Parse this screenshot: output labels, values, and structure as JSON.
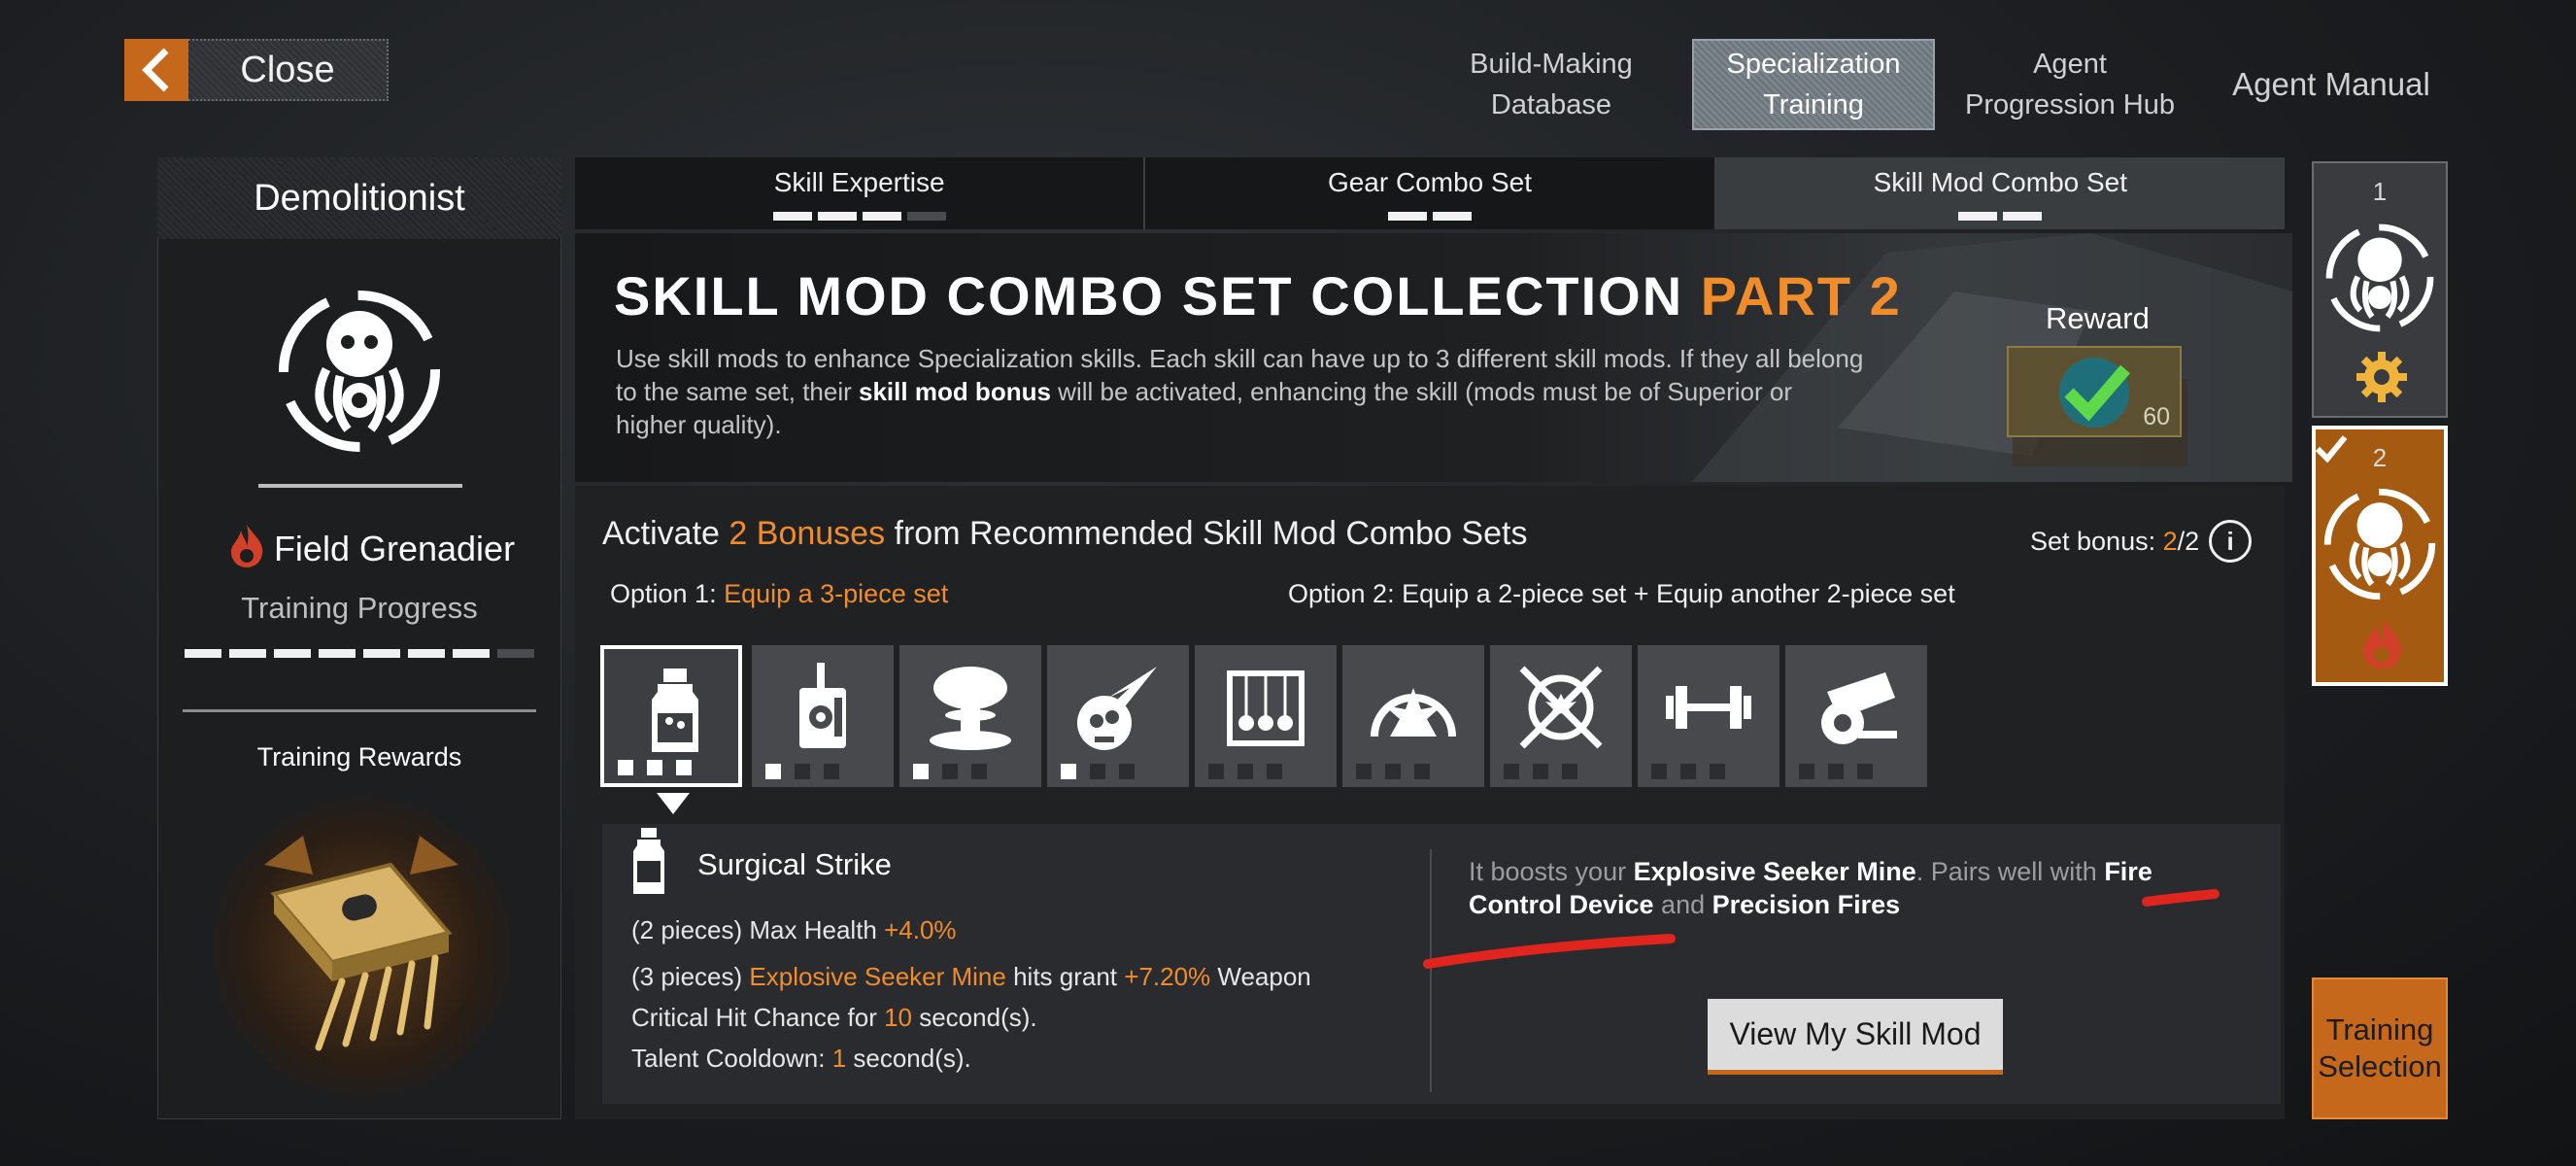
{
  "topbar": {
    "close_label": "Close",
    "nav": [
      {
        "label": "Build-Making Database",
        "active": false
      },
      {
        "label": "Specialization Training",
        "active": true
      },
      {
        "label": "Agent Progression Hub",
        "active": false
      },
      {
        "label": "Agent Manual",
        "active": false
      }
    ]
  },
  "left_panel": {
    "title": "Demolitionist",
    "specialization": "Field Grenadier",
    "progress_label": "Training Progress",
    "progress_segments_filled": 7,
    "progress_segments_total": 8,
    "rewards_label": "Training Rewards"
  },
  "tabs": [
    {
      "label": "Skill Expertise",
      "pips_on": 3,
      "pips_total": 4,
      "active": false
    },
    {
      "label": "Gear Combo Set",
      "pips_on": 2,
      "pips_total": 2,
      "active": false
    },
    {
      "label": "Skill Mod Combo Set",
      "pips_on": 2,
      "pips_total": 2,
      "active": true
    }
  ],
  "banner": {
    "title_main": "SKILL MOD COMBO SET COLLECTION",
    "title_part": "PART 2",
    "desc_1": "Use skill mods to enhance Specialization skills. Each skill can have up to 3 different skill mods. If they all belong to the same set, their ",
    "desc_bold": "skill mod bonus",
    "desc_2": " will be activated, enhancing the skill (mods must be of Superior or higher quality).",
    "reward_label": "Reward",
    "reward_amount": "60"
  },
  "activate": {
    "prefix": "Activate ",
    "count": "2",
    "bonuses": "Bonuses",
    "suffix": " from Recommended Skill Mod Combo Sets",
    "set_bonus_label": "Set bonus: ",
    "set_bonus_current": "2",
    "set_bonus_total": "/2",
    "option1_label": "Option 1: ",
    "option1_text": "Equip a 3-piece set",
    "option2_label": "Option 2: ",
    "option2_text": "Equip a 2-piece set + Equip another 2-piece set"
  },
  "mod_sets": [
    {
      "icon": "bottle-icon",
      "pips_on": 3
    },
    {
      "icon": "radio-device-icon",
      "pips_on": 1
    },
    {
      "icon": "mushroom-cloud-icon",
      "pips_on": 1
    },
    {
      "icon": "flaming-skull-icon",
      "pips_on": 1
    },
    {
      "icon": "newtons-cradle-icon",
      "pips_on": 0
    },
    {
      "icon": "explosion-dome-icon",
      "pips_on": 0
    },
    {
      "icon": "crosshair-burst-icon",
      "pips_on": 0
    },
    {
      "icon": "dumbbell-icon",
      "pips_on": 0
    },
    {
      "icon": "cannon-icon",
      "pips_on": 0
    }
  ],
  "detail": {
    "name": "Surgical Strike",
    "line1_prefix": "(2 pieces) Max Health ",
    "line1_value": "+4.0%",
    "line2_prefix": "(3 pieces) ",
    "line2_skill": "Explosive Seeker Mine",
    "line2_mid": " hits grant ",
    "line2_value": "+7.20%",
    "line2_suffix": " Weapon",
    "line3_prefix": "Critical Hit Chance for ",
    "line3_value": "10",
    "line3_suffix": " second(s).",
    "line4_prefix": "Talent Cooldown: ",
    "line4_value": "1",
    "line4_suffix": " second(s).",
    "pairs_1": "It boosts your ",
    "pairs_skill": "Explosive Seeker Mine",
    "pairs_2": ". Pairs well with ",
    "pairs_mod1": "Fire Control Device",
    "pairs_3": " and ",
    "pairs_mod2": "Precision Fires",
    "view_button": "View My Skill Mod"
  },
  "right_column": {
    "stage1_num": "1",
    "stage2_num": "2",
    "training_selection": "Training Selection"
  },
  "colors": {
    "accent_orange": "#f08c2a",
    "annotation_red": "#e0241e"
  }
}
